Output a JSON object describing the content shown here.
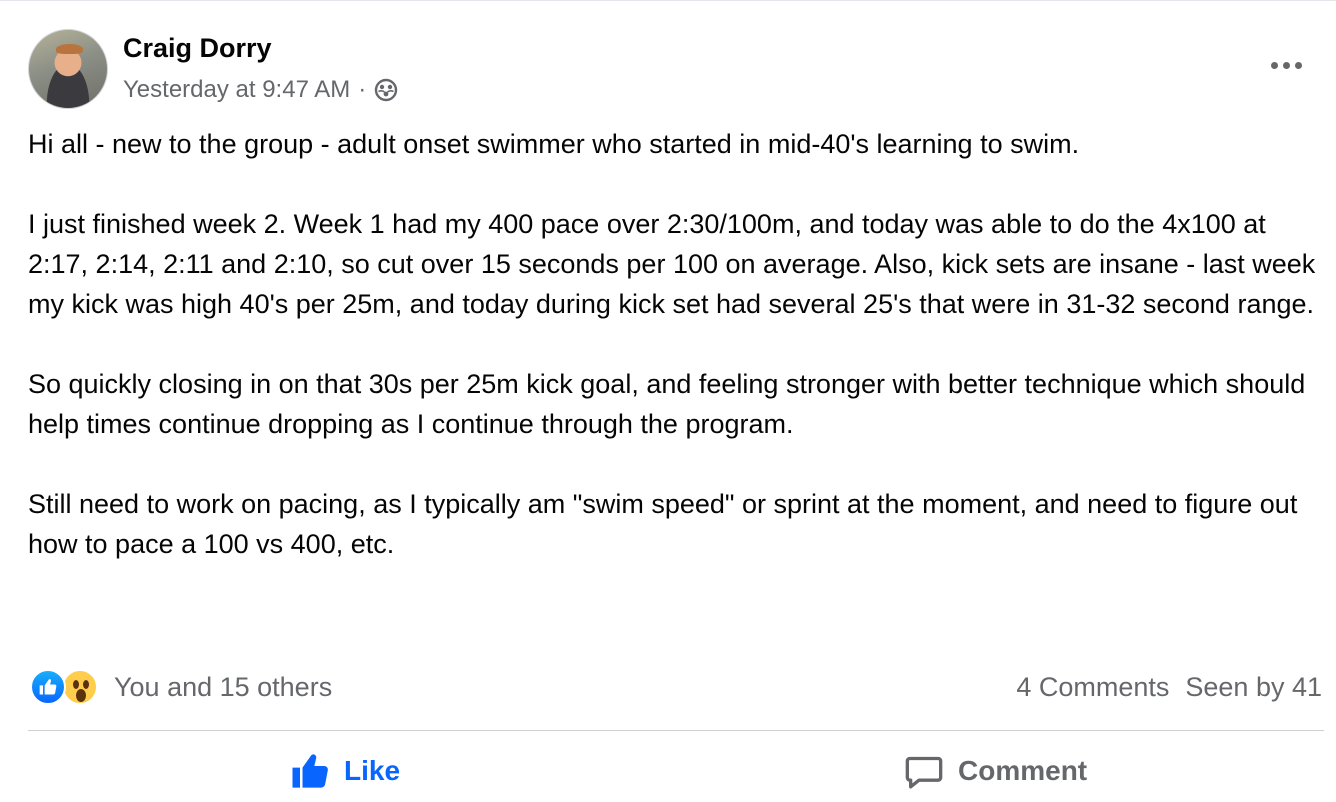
{
  "post": {
    "author": "Craig Dorry",
    "timestamp": "Yesterday at 9:47 AM",
    "separator": "·",
    "audience_icon": "group-privacy-icon",
    "more_icon": "more-options-icon",
    "body": [
      "Hi all - new to the group - adult onset swimmer who started in mid-40's learning to swim.",
      "I just finished week 2. Week 1 had my 400 pace over 2:30/100m, and today was able to do the 4x100 at 2:17, 2:14, 2:11 and 2:10, so cut over 15 seconds per 100 on average. Also, kick sets are insane - last week my kick was high 40's per 25m, and today during kick set had several 25's that were in 31-32 second range.",
      "So quickly closing in on that 30s per 25m kick goal, and feeling stronger with better technique which should help times continue dropping as I continue through the program.",
      "Still need to work on pacing, as I typically am \"swim speed\" or sprint at the moment, and need to figure out how to pace a 100 vs 400, etc."
    ]
  },
  "footer": {
    "reactions": [
      "like-reaction-icon",
      "wow-reaction-icon"
    ],
    "reactions_text": "You and 15 others",
    "comments_text": "4 Comments",
    "seen_text": "Seen by 41"
  },
  "actions": {
    "like_label": "Like",
    "comment_label": "Comment"
  },
  "colors": {
    "accent": "#0866ff",
    "secondary_text": "#65676b",
    "divider": "#ced0d4"
  }
}
